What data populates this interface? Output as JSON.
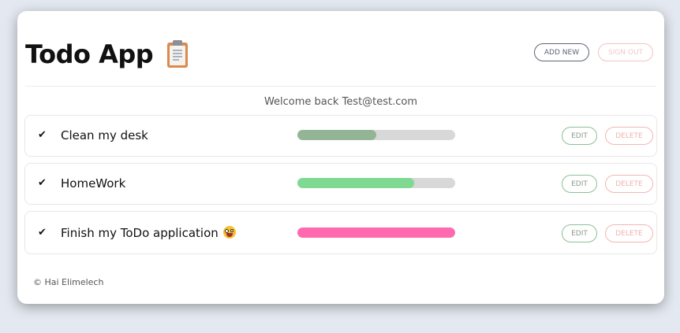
{
  "app": {
    "title": "Todo App",
    "title_icon": "clipboard-icon"
  },
  "header": {
    "add_new_label": "ADD NEW",
    "sign_out_label": "SIGN OUT"
  },
  "welcome_text": "Welcome back Test@test.com",
  "todos": [
    {
      "check": "✔",
      "label": "Clean my desk",
      "progress_percent": 50,
      "progress_color": "#93b595",
      "edit_label": "EDIT",
      "delete_label": "DELETE"
    },
    {
      "check": "✔",
      "label": "HomeWork",
      "progress_percent": 74,
      "progress_color": "#7fd993",
      "edit_label": "EDIT",
      "delete_label": "DELETE"
    },
    {
      "check": "✔",
      "label": "Finish my ToDo application",
      "label_emoji": "zany-face-emoji",
      "progress_percent": 100,
      "progress_color": "#ff69b0",
      "edit_label": "EDIT",
      "delete_label": "DELETE"
    }
  ],
  "footer": {
    "text": "© Hai Elimelech"
  },
  "colors": {
    "background": "#e4e9f1",
    "card": "#ffffff",
    "edit_border": "#8fbf96",
    "delete_border": "#f2b7b3"
  }
}
